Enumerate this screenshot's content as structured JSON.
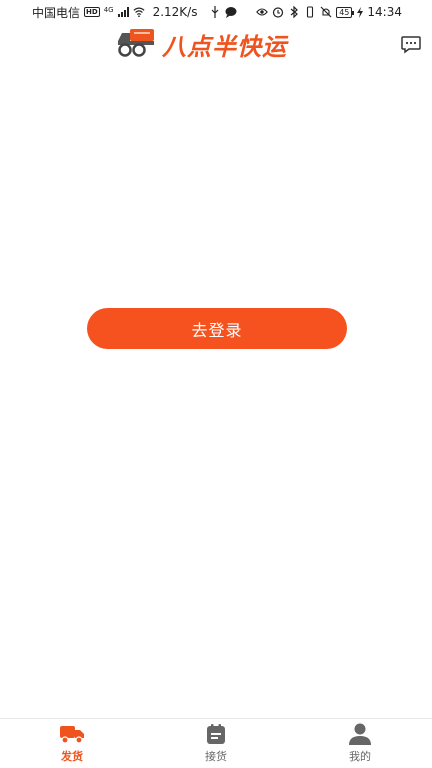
{
  "status_bar": {
    "carrier": "中国电信",
    "hd_badge": "HD",
    "network_type": "4G",
    "speed": "2.12K/s",
    "battery": "45",
    "time": "14:34"
  },
  "header": {
    "logo_text": "八点半快运",
    "message_icon": "chat-bubble-icon"
  },
  "main": {
    "login_button": "去登录"
  },
  "tabbar": {
    "tabs": [
      {
        "label": "发货",
        "icon": "truck-icon",
        "active": true
      },
      {
        "label": "接货",
        "icon": "calendar-icon",
        "active": false
      },
      {
        "label": "我的",
        "icon": "person-icon",
        "active": false
      }
    ]
  },
  "colors": {
    "accent": "#f6521f",
    "tab_inactive": "#666666",
    "background": "#ffffff"
  }
}
